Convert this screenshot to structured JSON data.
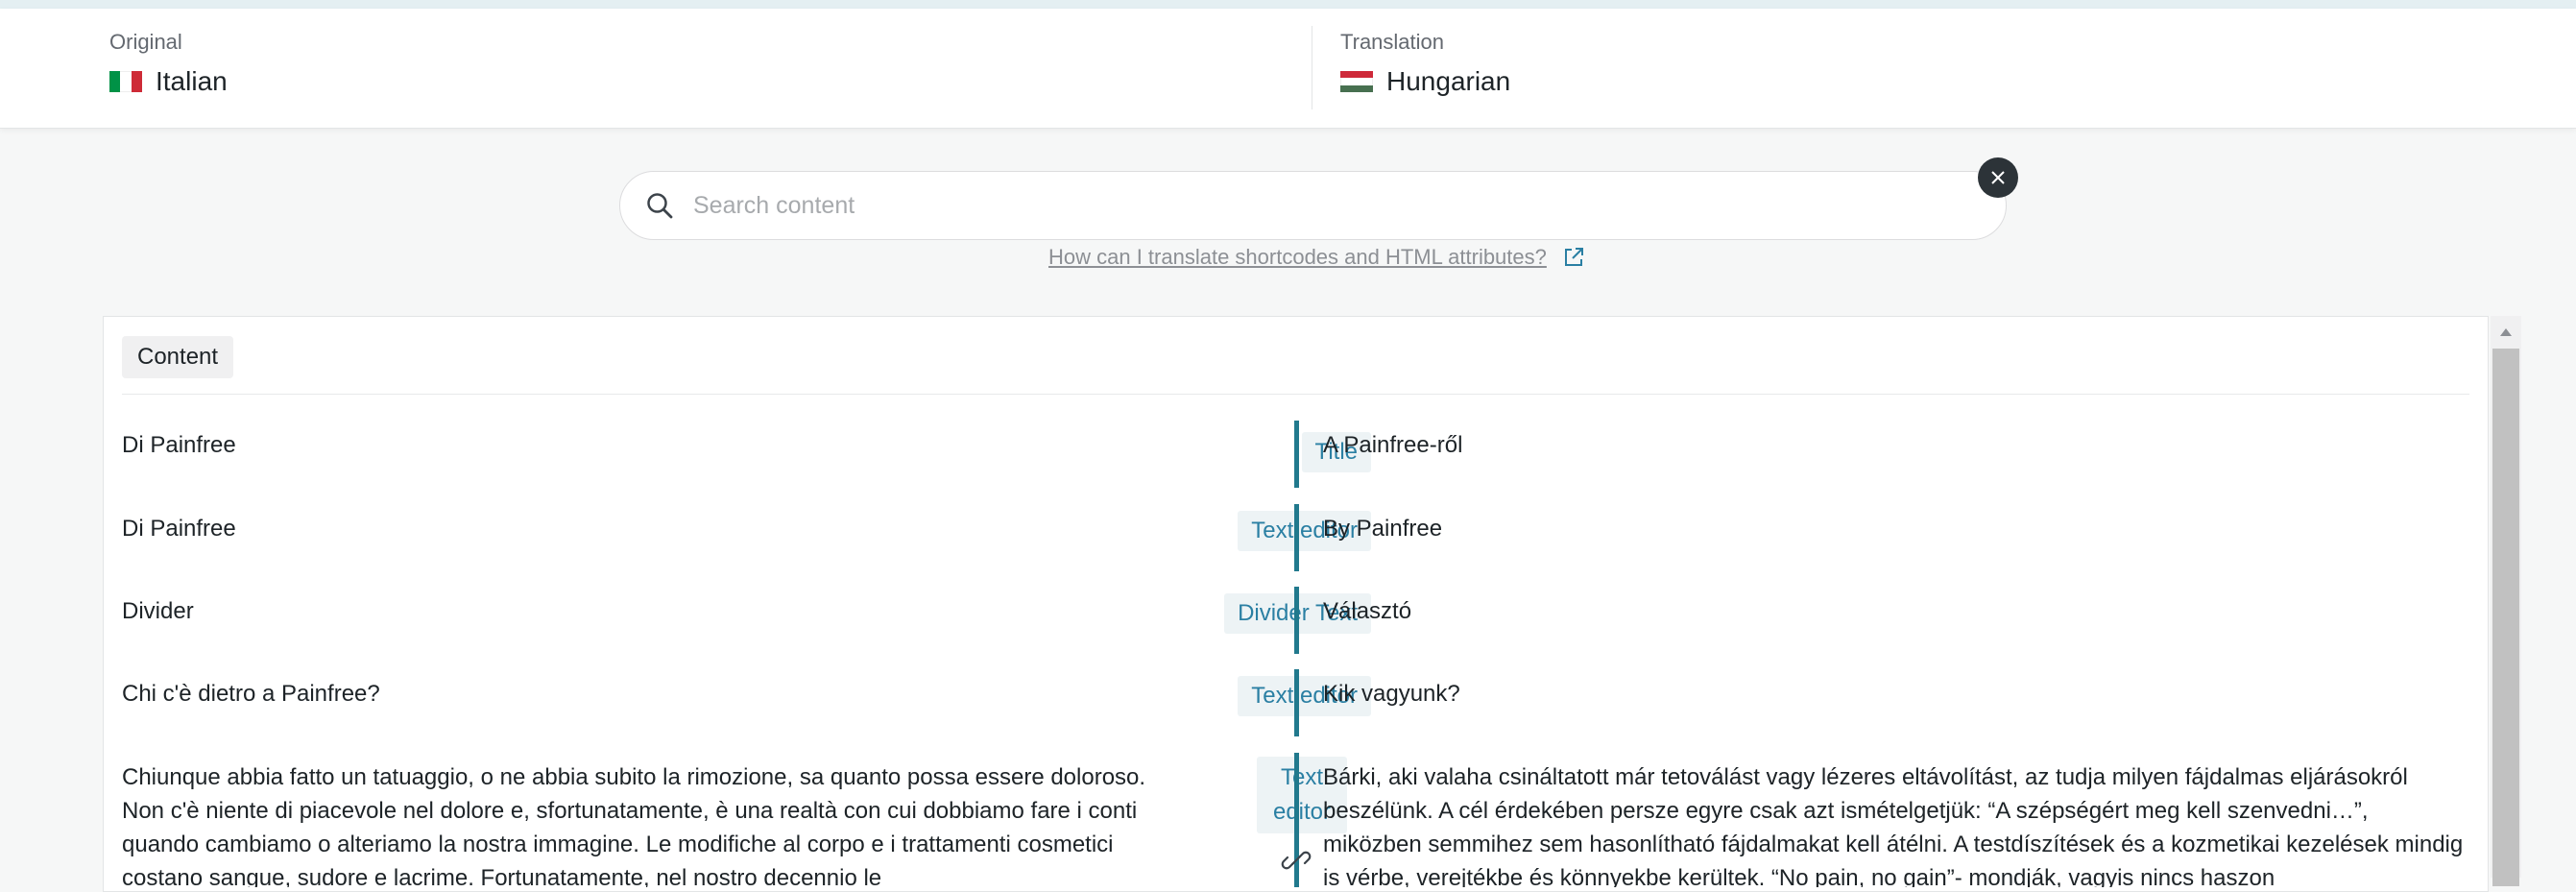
{
  "header": {
    "original_caption": "Original",
    "original_language": "Italian",
    "translation_caption": "Translation",
    "translation_language": "Hungarian"
  },
  "search": {
    "placeholder": "Search content",
    "help_link": "How can I translate shortcodes and HTML attributes?"
  },
  "section": {
    "label": "Content"
  },
  "rows": [
    {
      "original": "Di Painfree",
      "type": "Title",
      "translation": "A Painfree-ről"
    },
    {
      "original": "Di Painfree",
      "type": "Text editor",
      "translation": "By Painfree"
    },
    {
      "original": "Divider",
      "type": "Divider Text",
      "translation": "Választó"
    },
    {
      "original": "Chi c'è dietro a Painfree?",
      "type": "Text editor",
      "translation": "Kik vagyunk?"
    },
    {
      "original": "Chiunque abbia fatto un tatuaggio, o ne abbia subito la rimozione, sa quanto possa essere doloroso. Non c'è niente di piacevole nel dolore e, sfortunatamente, è una realtà con cui dobbiamo fare i conti quando cambiamo o alteriamo la nostra immagine. Le modifiche al corpo e i trattamenti cosmetici costano sangue, sudore e lacrime. Fortunatamente, nel nostro decennio le",
      "type": "Text editor",
      "translation": "Bárki, aki valaha csináltatott már tetoválást vagy lézeres eltávolítást, az tudja milyen fájdalmas eljárásokról beszélünk. A cél érdekében persze egyre csak azt ismételgetjük: “A szépségért meg kell szenvedni…”, miközben semmihez sem hasonlítható fájdalmakat kell átélni. A testdíszítések és a kozmetikai kezelések mindig is vérbe, verejtékbe és könnyekbe kerültek. “No pain, no gain”- mondják, vagyis nincs haszon"
    }
  ],
  "colors": {
    "accent_bar": "#21798d",
    "badge_text": "#2a7fa3",
    "badge_bg": "#edf3f5",
    "flag_it": [
      "#009246",
      "#ffffff",
      "#ce2b37"
    ],
    "flag_hu": [
      "#ce2939",
      "#ffffff",
      "#477050"
    ]
  },
  "icons": {
    "search": "search-icon",
    "clear": "close-icon",
    "external": "external-link-icon",
    "link": "link-icon"
  }
}
